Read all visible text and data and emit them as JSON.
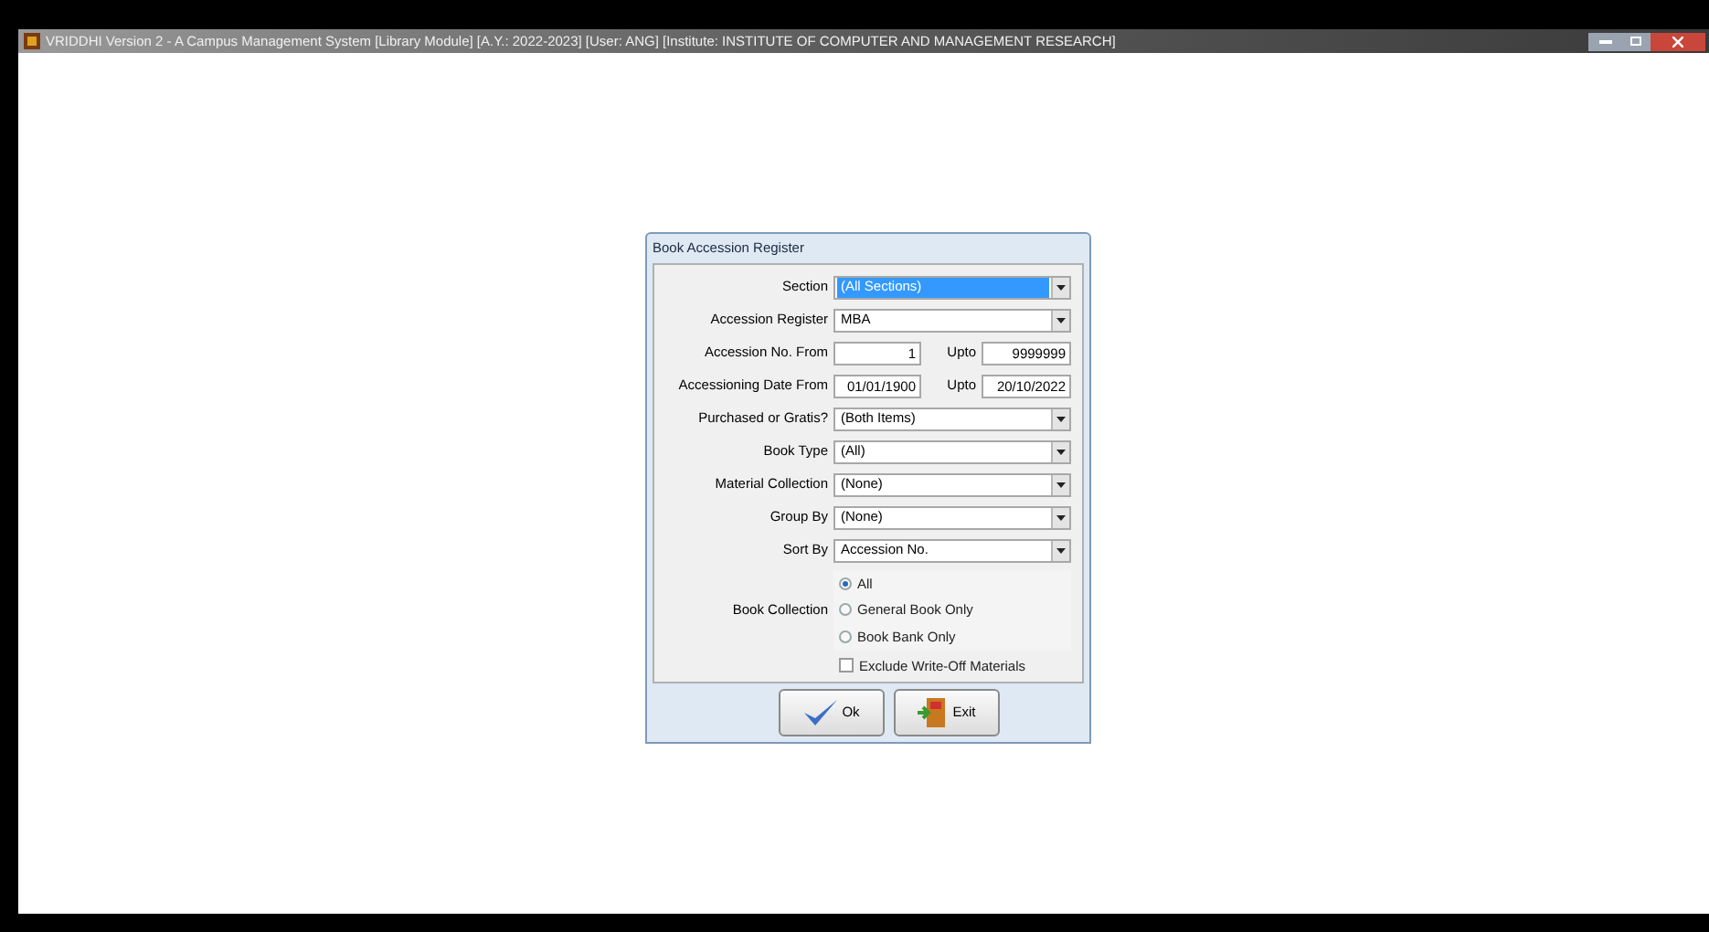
{
  "window": {
    "title": "VRIDDHI Version 2 - A Campus Management System [Library Module] [A.Y.: 2022-2023] [User: ANG] [Institute: INSTITUTE OF COMPUTER AND MANAGEMENT RESEARCH]"
  },
  "dialog": {
    "title": "Book Accession Register",
    "fields": [
      {
        "kind": "dropdown",
        "label": "Section",
        "value": "(All Sections)",
        "selected": true
      },
      {
        "kind": "dropdown",
        "label": "Accession Register",
        "value": "MBA",
        "selected": false
      },
      {
        "kind": "range",
        "label": "Accession No. From",
        "value": "1",
        "upto_label": "Upto",
        "upto_value": "9999999"
      },
      {
        "kind": "range",
        "label": "Accessioning Date From",
        "value": "01/01/1900",
        "upto_label": "Upto",
        "upto_value": "20/10/2022"
      },
      {
        "kind": "dropdown",
        "label": "Purchased or Gratis?",
        "value": "(Both Items)",
        "selected": false
      },
      {
        "kind": "dropdown",
        "label": "Book Type",
        "value": "(All)",
        "selected": false
      },
      {
        "kind": "dropdown",
        "label": "Material Collection",
        "value": "(None)",
        "selected": false
      },
      {
        "kind": "dropdown",
        "label": "Group By",
        "value": "(None)",
        "selected": false
      },
      {
        "kind": "dropdown",
        "label": "Sort By",
        "value": "Accession No.",
        "selected": false
      }
    ],
    "book_collection": {
      "label": "Book Collection",
      "options": [
        {
          "label": "All",
          "selected": true
        },
        {
          "label": "General Book Only",
          "selected": false
        },
        {
          "label": "Book Bank Only",
          "selected": false
        }
      ]
    },
    "exclude_write_off": {
      "label": "Exclude Write-Off Materials",
      "checked": false
    },
    "buttons": [
      {
        "kind": "ok",
        "label": "Ok"
      },
      {
        "kind": "exit",
        "label": "Exit"
      }
    ]
  }
}
